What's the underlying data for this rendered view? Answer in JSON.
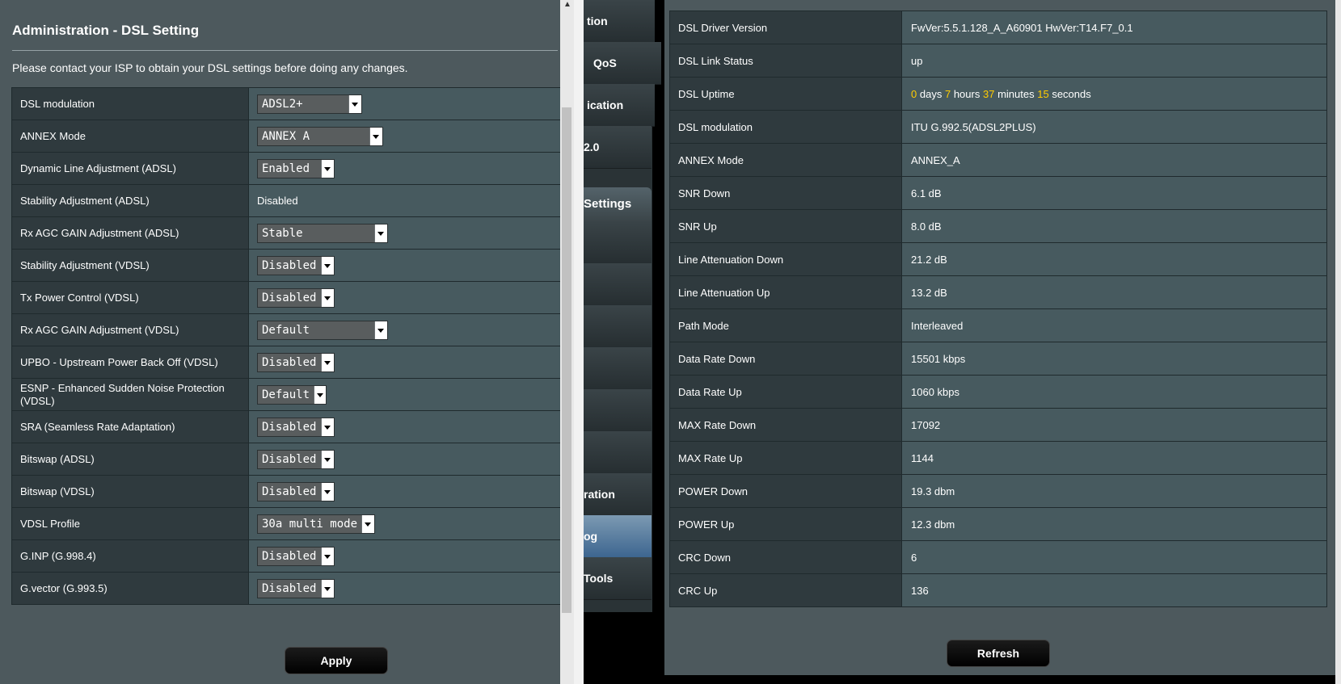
{
  "left": {
    "title": "Administration - DSL Setting",
    "description": "Please contact your ISP to obtain your DSL settings before doing any changes.",
    "rows": [
      {
        "label": "DSL modulation",
        "type": "select",
        "value": "ADSL2+"
      },
      {
        "label": "ANNEX Mode",
        "type": "select",
        "value": "ANNEX A"
      },
      {
        "label": "Dynamic Line Adjustment (ADSL)",
        "type": "select",
        "value": "Enabled"
      },
      {
        "label": "Stability Adjustment (ADSL)",
        "type": "text",
        "value": "Disabled"
      },
      {
        "label": "Rx AGC GAIN Adjustment (ADSL)",
        "type": "select",
        "value": "Stable"
      },
      {
        "label": "Stability Adjustment (VDSL)",
        "type": "select",
        "value": "Disabled"
      },
      {
        "label": "Tx Power Control (VDSL)",
        "type": "select",
        "value": "Disabled"
      },
      {
        "label": "Rx AGC GAIN Adjustment (VDSL)",
        "type": "select",
        "value": "Default"
      },
      {
        "label": "UPBO - Upstream Power Back Off (VDSL)",
        "type": "select",
        "value": "Disabled"
      },
      {
        "label": "ESNP - Enhanced Sudden Noise Protection (VDSL)",
        "type": "select",
        "value": "Default"
      },
      {
        "label": "SRA (Seamless Rate Adaptation)",
        "type": "select",
        "value": "Disabled"
      },
      {
        "label": "Bitswap (ADSL)",
        "type": "select",
        "value": "Disabled"
      },
      {
        "label": "Bitswap (VDSL)",
        "type": "select",
        "value": "Disabled"
      },
      {
        "label": "VDSL Profile",
        "type": "select",
        "value": "30a multi mode"
      },
      {
        "label": "G.INP (G.998.4)",
        "type": "select",
        "value": "Disabled"
      },
      {
        "label": "G.vector (G.993.5)",
        "type": "select",
        "value": "Disabled"
      }
    ],
    "apply_label": "Apply"
  },
  "sidebar": {
    "items": [
      "tion",
      "QoS",
      "ication",
      "2.0"
    ],
    "header": "Settings",
    "items2": [
      "",
      "",
      "",
      "",
      "",
      "",
      "ration",
      "og",
      "Tools"
    ],
    "active_index": 7
  },
  "right": {
    "rows": [
      {
        "label": "DSL Driver Version",
        "value": "FwVer:5.5.1.128_A_A60901 HwVer:T14.F7_0.1"
      },
      {
        "label": "DSL Link Status",
        "value": "up"
      },
      {
        "label": "DSL Uptime",
        "uptime": {
          "days": "0",
          "days_label": "days",
          "hours": "7",
          "hours_label": "hours",
          "minutes": "37",
          "minutes_label": "minutes",
          "seconds": "15",
          "seconds_label": "seconds"
        }
      },
      {
        "label": "DSL modulation",
        "value": "ITU G.992.5(ADSL2PLUS)"
      },
      {
        "label": "ANNEX Mode",
        "value": "ANNEX_A"
      },
      {
        "label": "SNR Down",
        "value": "6.1 dB"
      },
      {
        "label": "SNR Up",
        "value": "8.0 dB"
      },
      {
        "label": "Line Attenuation Down",
        "value": "21.2 dB"
      },
      {
        "label": "Line Attenuation Up",
        "value": "13.2 dB"
      },
      {
        "label": "Path Mode",
        "value": "Interleaved"
      },
      {
        "label": "Data Rate Down",
        "value": "15501 kbps"
      },
      {
        "label": "Data Rate Up",
        "value": "1060 kbps"
      },
      {
        "label": "MAX Rate Down",
        "value": "17092"
      },
      {
        "label": "MAX Rate Up",
        "value": "1144"
      },
      {
        "label": "POWER Down",
        "value": "19.3 dbm"
      },
      {
        "label": "POWER Up",
        "value": "12.3 dbm"
      },
      {
        "label": "CRC Down",
        "value": "6"
      },
      {
        "label": "CRC Up",
        "value": "136"
      }
    ],
    "refresh_label": "Refresh"
  },
  "colors": {
    "highlight": "#ffcc00",
    "active_menu": "#3d6690"
  }
}
